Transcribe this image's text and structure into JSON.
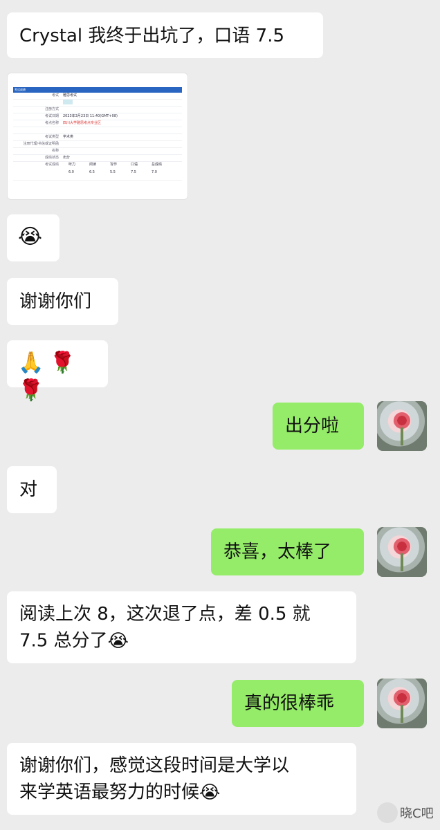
{
  "messages": {
    "m1": {
      "side": "left",
      "text": "Crystal 我终于出坑了，口语 7.5"
    },
    "m2": {
      "side": "left",
      "type": "image",
      "screenshot": {
        "header_label": "考试成绩",
        "rows": [
          {
            "label": "考试",
            "value": "雅思考试"
          },
          {
            "label": "",
            "value": ""
          },
          {
            "label": "注册方式",
            "value": ""
          },
          {
            "label": "考试日期",
            "value": "2023年3月23日 11:40(GMT+08)"
          },
          {
            "label": "考点名称",
            "value": "四川大学雅思考点专业区"
          },
          {
            "label": "",
            "value": ""
          },
          {
            "label": "考试类型",
            "value": "学术类"
          },
          {
            "label": "注册代理/书信或证明函",
            "value": ""
          },
          {
            "label": "名称",
            "value": ""
          },
          {
            "label": "成绩状态",
            "value": "出分"
          },
          {
            "label": "考试成绩",
            "value": ""
          }
        ],
        "score_headers": [
          "听力",
          "阅读",
          "写作",
          "口语",
          "总成绩"
        ],
        "scores": [
          "6.0",
          "6.5",
          "5.5",
          "7.5",
          "7.0"
        ]
      }
    },
    "m3": {
      "side": "left",
      "emoji_name": "crying-face-icon",
      "emoji": "😭"
    },
    "m4": {
      "side": "left",
      "text": "谢谢你们"
    },
    "m5": {
      "side": "left",
      "emojis": [
        "🙏",
        "🌹",
        "🌹"
      ]
    },
    "m6": {
      "side": "right",
      "text": "出分啦"
    },
    "m7": {
      "side": "left",
      "text": "对"
    },
    "m8": {
      "side": "right",
      "text": "恭喜，太棒了"
    },
    "m9": {
      "side": "left",
      "text_line1": "阅读上次 8，这次退了点，差 0.5 就",
      "text_line2": "7.5 总分了",
      "trailing_emoji": "😭"
    },
    "m10": {
      "side": "right",
      "text": "真的很棒乖"
    },
    "m11": {
      "side": "left",
      "text_line1": "谢谢你们，感觉这段时间是大学以",
      "text_line2": "来学英语最努力的时候",
      "trailing_emoji": "😭"
    }
  },
  "footer": {
    "brand": "晓C吧"
  },
  "colors": {
    "right_bubble": "#95ec69",
    "left_bubble": "#ffffff",
    "background": "#ececec"
  }
}
